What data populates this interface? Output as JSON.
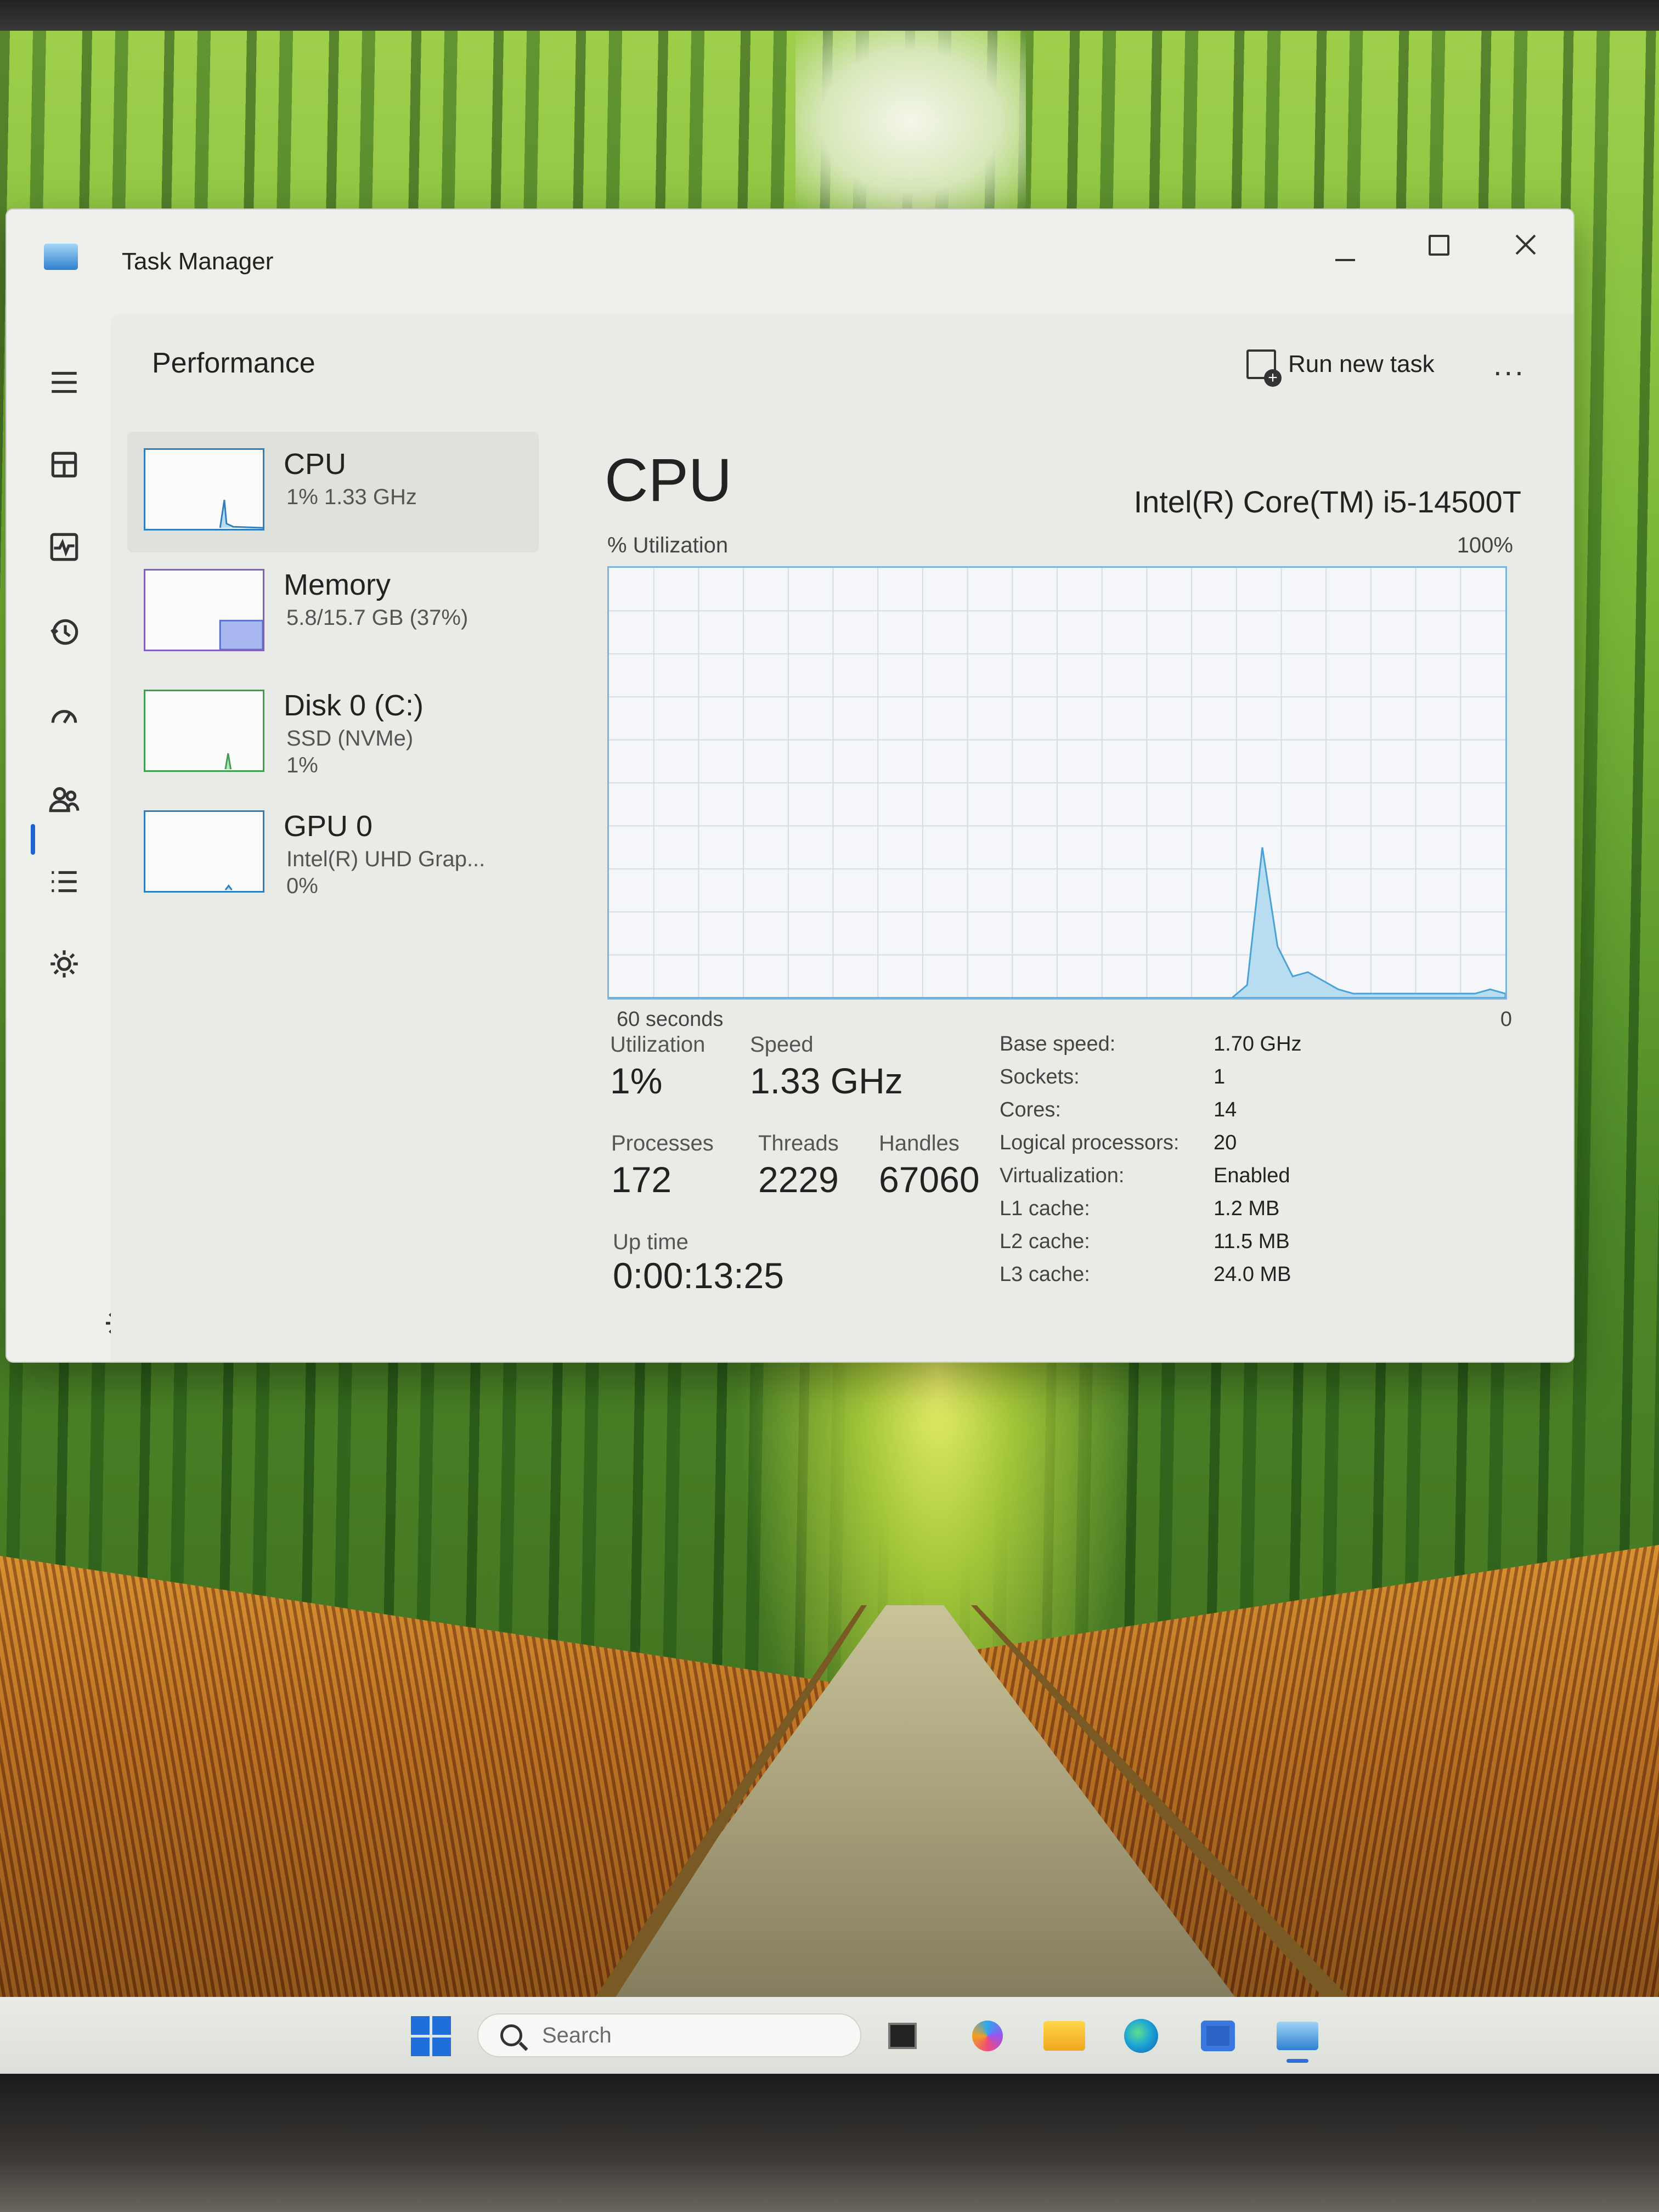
{
  "window": {
    "title": "Task Manager"
  },
  "header": {
    "page_title": "Performance",
    "run_new_task": "Run new task",
    "more": "..."
  },
  "resources": [
    {
      "name": "CPU",
      "sub": "1% 1.33 GHz",
      "sub2": ""
    },
    {
      "name": "Memory",
      "sub": "5.8/15.7 GB (37%)",
      "sub2": ""
    },
    {
      "name": "Disk 0 (C:)",
      "sub": "SSD (NVMe)",
      "sub2": "1%"
    },
    {
      "name": "GPU 0",
      "sub": "Intel(R) UHD Grap...",
      "sub2": "0%"
    }
  ],
  "detail": {
    "title": "CPU",
    "model": "Intel(R) Core(TM) i5-14500T",
    "util_label": "% Utilization",
    "util_max": "100%",
    "axis_left": "60 seconds",
    "axis_right": "0"
  },
  "stats": {
    "utilization_label": "Utilization",
    "utilization": "1%",
    "speed_label": "Speed",
    "speed": "1.33 GHz",
    "processes_label": "Processes",
    "processes": "172",
    "threads_label": "Threads",
    "threads": "2229",
    "handles_label": "Handles",
    "handles": "67060",
    "uptime_label": "Up time",
    "uptime": "0:00:13:25"
  },
  "specs": [
    {
      "label": "Base speed:",
      "value": "1.70 GHz"
    },
    {
      "label": "Sockets:",
      "value": "1"
    },
    {
      "label": "Cores:",
      "value": "14"
    },
    {
      "label": "Logical processors:",
      "value": "20"
    },
    {
      "label": "Virtualization:",
      "value": "Enabled"
    },
    {
      "label": "L1 cache:",
      "value": "1.2 MB"
    },
    {
      "label": "L2 cache:",
      "value": "11.5 MB"
    },
    {
      "label": "L3 cache:",
      "value": "24.0 MB"
    }
  ],
  "cpu_history": [
    0,
    0,
    0,
    0,
    0,
    0,
    0,
    0,
    0,
    0,
    0,
    0,
    0,
    0,
    0,
    0,
    0,
    0,
    0,
    0,
    0,
    0,
    0,
    0,
    0,
    0,
    0,
    0,
    0,
    0,
    0,
    0,
    0,
    0,
    0,
    0,
    0,
    0,
    0,
    0,
    0,
    0,
    3,
    35,
    12,
    5,
    6,
    4,
    2,
    1,
    1,
    1,
    1,
    1,
    1,
    1,
    1,
    1,
    2,
    1
  ],
  "accent_color": "#4aa3d8",
  "taskbar": {
    "search_placeholder": "Search"
  }
}
